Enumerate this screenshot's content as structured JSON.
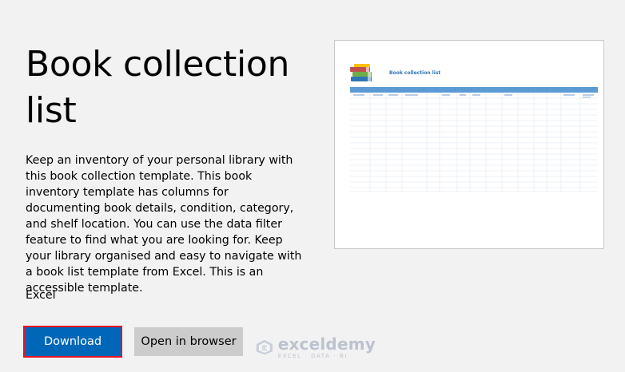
{
  "title": "Book collection list",
  "description": "Keep an inventory of your personal library with this book collection template. This book inventory template has columns for documenting book details, condition, category, and shelf location. You can use the data filter feature to find what you are looking for. Keep your library organised and easy to navigate with a book list template from Excel. This is an accessible template.",
  "app_name": "Excel",
  "buttons": {
    "download": "Download",
    "open_in_browser": "Open in browser"
  },
  "watermark": {
    "brand": "exceldemy",
    "tagline": "EXCEL · DATA · BI"
  },
  "preview": {
    "sheet_title": "Book collection list"
  },
  "colors": {
    "accent": "#0067b8",
    "focus_border": "#e81123",
    "secondary_button": "#cccccc",
    "sheet_header": "#5b9bd5"
  }
}
